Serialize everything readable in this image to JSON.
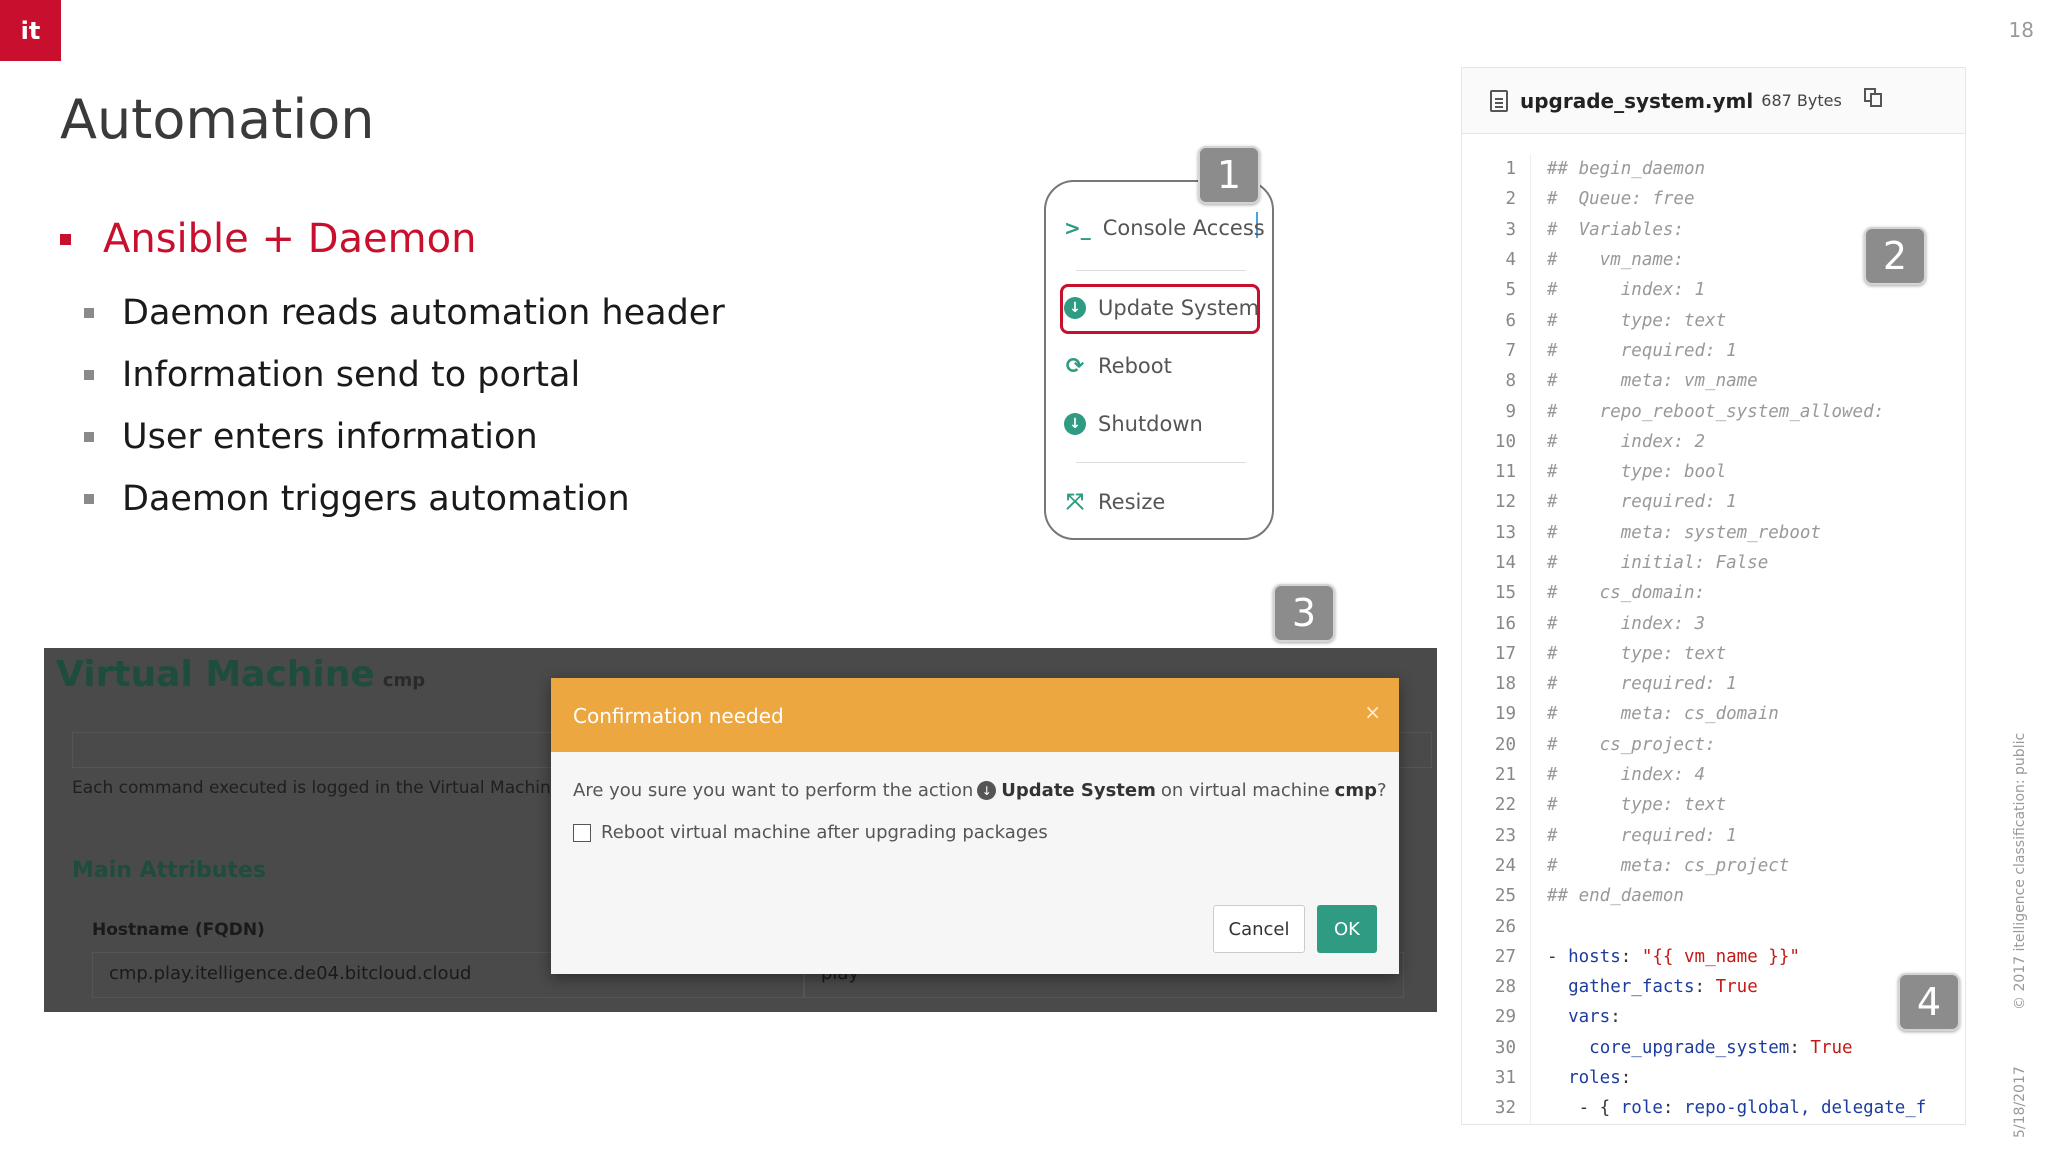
{
  "logo": "it",
  "page_number": "18",
  "title": "Automation",
  "bullets": {
    "main": "Ansible + Daemon",
    "subs": [
      "Daemon reads automation header",
      "Information send to portal",
      "User enters information",
      "Daemon triggers automation"
    ]
  },
  "markers": [
    "1",
    "2",
    "3",
    "4"
  ],
  "menu": {
    "console_icon": ">_",
    "console": "Console Access",
    "update": "Update System",
    "reboot": "Reboot",
    "shutdown": "Shutdown",
    "resize": "Resize"
  },
  "vm": {
    "title": "Virtual Machine",
    "subtitle": "cmp",
    "note": "Each command executed is logged in the Virtual Machine h",
    "section": "Main Attributes",
    "hostname_label": "Hostname (FQDN)",
    "hostname_value": "cmp.play.itelligence.de04.bitcloud.cloud",
    "second_value": "play"
  },
  "modal": {
    "title": "Confirmation needed",
    "close": "×",
    "msg_prefix": "Are you sure you want to perform the action",
    "action": "Update System",
    "msg_mid": "on virtual machine",
    "vm": "cmp",
    "msg_end": "?",
    "checkbox_label": "Reboot virtual machine after upgrading packages",
    "cancel": "Cancel",
    "ok": "OK"
  },
  "file": {
    "name": "upgrade_system.yml",
    "size": "687 Bytes"
  },
  "code_lines": [
    "## begin_daemon",
    "#  Queue: free",
    "#  Variables:",
    "#    vm_name:",
    "#      index: 1",
    "#      type: text",
    "#      required: 1",
    "#      meta: vm_name",
    "#    repo_reboot_system_allowed:",
    "#      index: 2",
    "#      type: bool",
    "#      required: 1",
    "#      meta: system_reboot",
    "#      initial: False",
    "#    cs_domain:",
    "#      index: 3",
    "#      type: text",
    "#      required: 1",
    "#      meta: cs_domain",
    "#    cs_project:",
    "#      index: 4",
    "#      type: text",
    "#      required: 1",
    "#      meta: cs_project",
    "## end_daemon",
    "",
    "- hosts: \"{{ vm_name }}\"",
    "  gather_facts: True",
    "  vars:",
    "    core_upgrade_system: True",
    "  roles:",
    "   - { role: repo-global, delegate_f"
  ],
  "side_text": "© 2017 itelligence   classification: public",
  "date": "5/18/2017"
}
